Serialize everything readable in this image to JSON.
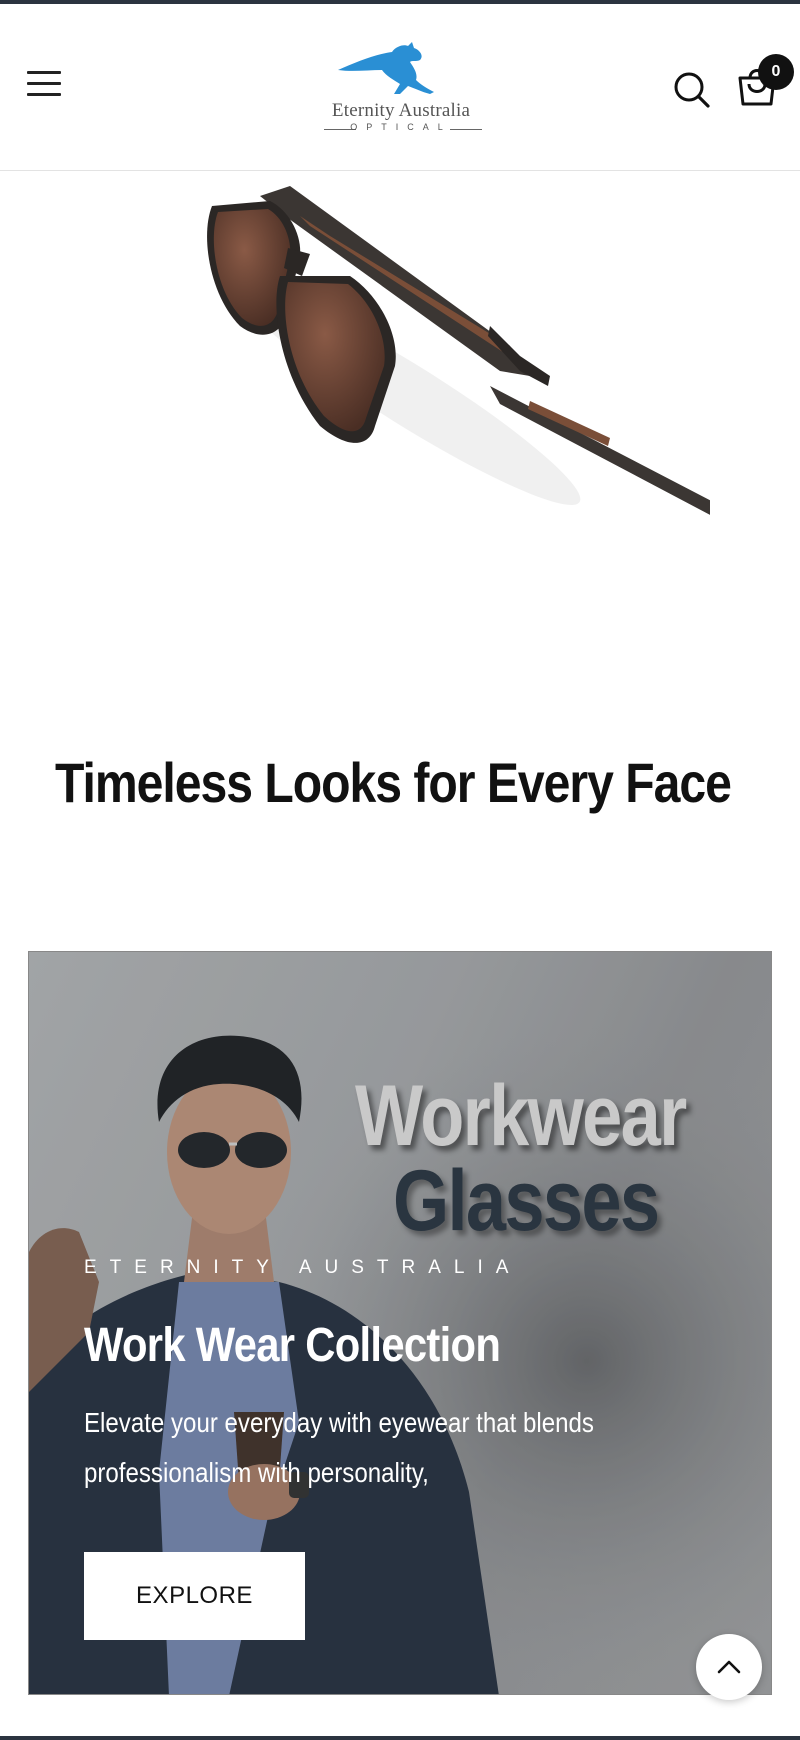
{
  "header": {
    "menu_icon": "hamburger-menu-icon",
    "logo": {
      "name": "Eternity Australia",
      "tagline": "OPTICAL",
      "icon": "kangaroo-logo-icon",
      "brand_color": "#2a8fd4"
    },
    "search_icon": "search-icon",
    "cart_icon": "shopping-bag-icon",
    "cart_count": "0"
  },
  "hero": {
    "image": "brown-tinted-sunglasses-product-image"
  },
  "section": {
    "title": "Timeless Looks for Every Face"
  },
  "banner": {
    "headline_line1": "Workwear",
    "headline_line2": "Glasses",
    "eyebrow": "ETERNITY AUSTRALIA",
    "title": "Work Wear Collection",
    "description": "Elevate your everyday with eyewear that blends professionalism with personality,",
    "button_label": "EXPLORE",
    "image": "man-in-blazer-wearing-aviator-sunglasses-image"
  },
  "scroll_top_icon": "chevron-up-icon",
  "colors": {
    "text": "#111111",
    "header_strip": "#2b3440",
    "banner_overlay": "#9c9ea1",
    "headline_dark": "#2a3540",
    "headline_light": "#c9c9c9"
  }
}
